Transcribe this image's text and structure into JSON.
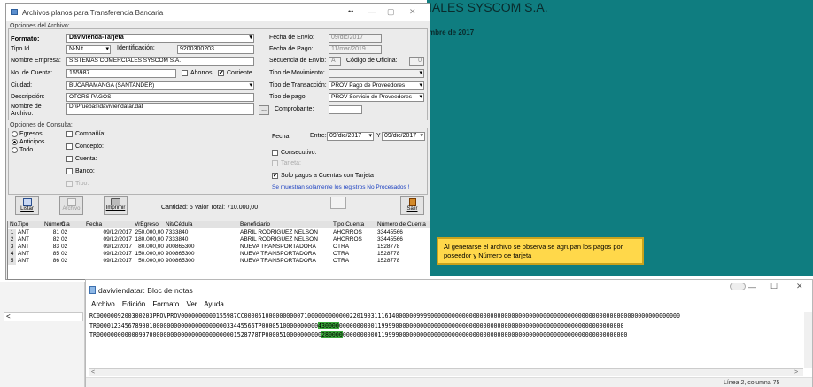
{
  "bg": {
    "teal_title": "IALES SYSCOM S.A.",
    "teal_sub": "mbre de 2017",
    "callout": "Al generarse el archivo se observa se agrupan los pagos por poseedor y Número de tarjeta",
    "left_scroll": "<"
  },
  "win": {
    "title": "Archivos planos para Transferencia Bancaria",
    "tb_extra": "••",
    "tb_min": "—",
    "tb_max": "▢",
    "tb_close": "✕"
  },
  "archivo": {
    "group": "Opciones del Archivo:",
    "formato_lbl": "Formato:",
    "formato": "Davivienda-Tarjeta",
    "tipoid_lbl": "Tipo Id.",
    "tipoid": "N-Nit",
    "ident_lbl": "Identificación:",
    "ident": "9200300203",
    "nombre_lbl": "Nombre Empresa:",
    "nombre": "SISTEMAS COMERCIALES SYSCOM S.A.",
    "cuenta_lbl": "No. de Cuenta:",
    "cuenta": "155987",
    "ahorros": "Ahorros",
    "corriente": "Corriente",
    "ciudad_lbl": "Ciudad:",
    "ciudad": "BUCARAMANGA (SANTANDER)",
    "desc_lbl": "Descripción:",
    "desc": "OTORS PAGOS",
    "narch_lbl": "Nombre de Archivo:",
    "narch": "D:\\Pruebas\\daviviendatar.dat",
    "fenvio_lbl": "Fecha de Envío:",
    "fenvio": "09/dic/2017",
    "fpago_lbl": "Fecha de Pago:",
    "fpago": "11/mar/2019",
    "secuencia_lbl": "Secuencia de Envío:",
    "secuencia": "A",
    "codofi_lbl": "Código de Oficina:",
    "codofi": "0",
    "tipomov_lbl": "Tipo de Movimiento:",
    "tipotrans_lbl": "Tipo de Transacción:",
    "tipotrans": "PROV Pago de Proveedores",
    "tipopago_lbl": "Tipo de pago:",
    "tipopago": "PROV Servicio de Proveedores",
    "comprobante_lbl": "Comprobante:",
    "dots": "..."
  },
  "consulta": {
    "group": "Opciones de Consulta:",
    "egresos": "Egresos",
    "anticipos": "Anticipos",
    "todo": "Todo",
    "compania": "Compañía:",
    "concepto": "Concepto:",
    "cuenta": "Cuenta:",
    "banco": "Banco:",
    "tipo": "Tipo:",
    "fecha_lbl": "Fecha:",
    "entre_lbl": "Entre:",
    "desde": "09/dic/2017",
    "y_lbl": "Y",
    "hasta": "09/dic/2017",
    "consecutivo": "Consecutivo:",
    "tarjeta": "Tarjeta:",
    "solo": "Solo pagos a Cuentas con Tarjeta",
    "aviso": "Se muestran solamente los registros No Procesados !"
  },
  "toolbar": {
    "listar": "Listar",
    "archivo": "Archivo",
    "imprimir": "Imprimir",
    "cantidad": "Cantidad: 5 Valor Total: 710.000,00",
    "salir": "Salir"
  },
  "grid": {
    "headers": [
      "No.",
      "Tipo",
      "Número",
      "Cia",
      "Fecha",
      "VrEgreso",
      "Nit/Cédula",
      "Beneficiario",
      "Tipo Cuenta",
      "Número de Cuenta"
    ],
    "rows": [
      [
        "1",
        "ANT",
        "81",
        "02",
        "09/12/2017",
        "250.000,00",
        "7333840",
        "ABRIL RODRIGUEZ NELSON",
        "AHORROS",
        "33445566"
      ],
      [
        "2",
        "ANT",
        "82",
        "02",
        "09/12/2017",
        "180.000,00",
        "7333840",
        "ABRIL RODRIGUEZ NELSON",
        "AHORROS",
        "33445566"
      ],
      [
        "3",
        "ANT",
        "83",
        "02",
        "09/12/2017",
        "80.000,00",
        "900865300",
        "NUEVA TRANSPORTADORA",
        "OTRA",
        "1528778"
      ],
      [
        "4",
        "ANT",
        "85",
        "02",
        "09/12/2017",
        "150.000,00",
        "900865300",
        "NUEVA TRANSPORTADORA",
        "OTRA",
        "1528778"
      ],
      [
        "5",
        "ANT",
        "86",
        "02",
        "09/12/2017",
        "50.000,00",
        "900865300",
        "NUEVA TRANSPORTADORA",
        "OTRA",
        "1528778"
      ]
    ]
  },
  "notepad": {
    "title": "daviviendatar: Bloc de notas",
    "menu": [
      "Archivo",
      "Edición",
      "Formato",
      "Ver",
      "Ayuda"
    ],
    "line1": "RC0000009200300203PROVPROV0000000000155987CC0000510000000000710000000000002201903111614000000999900000000000000000000000000000000000000000000000000000000000000000000000",
    "line2a": "TR000012345678900100000000000000000000033445566TP0000510000000000",
    "line2h": "430000",
    "line2b": "000000000011999900000000000000000000000000000000000000000000000000000000000000000",
    "line3a": "TR0000000000009970000000000000000000000001528778TP0000510000000000",
    "line3h": "280000",
    "line3b": "000000000011999900000000000000000000000000000000000000000000000000000000000000000",
    "status": "Línea 2, columna 75",
    "min": "—",
    "max": "☐",
    "close": "✕",
    "sb_left": "<",
    "sb_right": ">"
  }
}
